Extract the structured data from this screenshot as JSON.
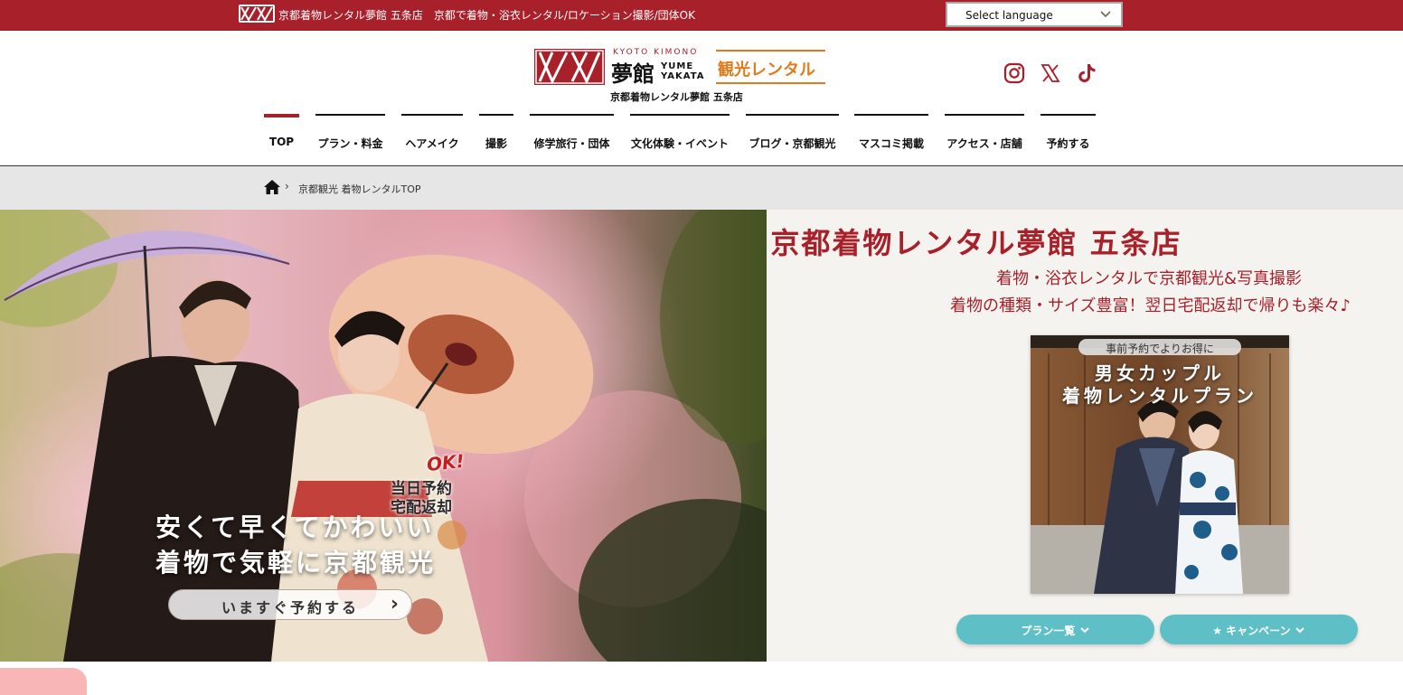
{
  "topbar": {
    "tagline": "京都着物レンタル夢館 五条店　京都で着物・浴衣レンタル/ロケーション撮影/団体OK",
    "language_select": "Select language"
  },
  "brand": {
    "kyoto_kimono": "KYOTO KIMONO",
    "kanji": "夢館",
    "yume_yakata_1": "YUME",
    "yume_yakata_2": "YAKATA",
    "tag": "観光レンタル",
    "store_sub": "京都着物レンタル夢館 五条店"
  },
  "social": [
    "instagram-icon",
    "x-icon",
    "tiktok-icon"
  ],
  "nav": {
    "items": [
      {
        "label": "TOP"
      },
      {
        "label": "プラン・料金"
      },
      {
        "label": "ヘアメイク"
      },
      {
        "label": "撮影"
      },
      {
        "label": "修学旅行・団体"
      },
      {
        "label": "文化体験・イベント"
      },
      {
        "label": "ブログ・京都観光"
      },
      {
        "label": "マスコミ掲載"
      },
      {
        "label": "アクセス・店舗"
      },
      {
        "label": "予約する"
      }
    ]
  },
  "breadcrumb": {
    "separator": "›",
    "current": "京都観光 着物レンタルTOP"
  },
  "hero": {
    "badge_ok": "OK!",
    "badge_line1": "当日予約",
    "badge_line2": "宅配返却",
    "line1": "安くて早くてかわいい",
    "line2": "着物で気軽に京都観光",
    "cta": "いますぐ予約する",
    "cta_arrow": "›"
  },
  "intro": {
    "title": "京都着物レンタル夢館 五条店",
    "lead1": "着物・浴衣レンタルで京都観光&写真撮影",
    "lead2": "着物の種類・サイズ豊富！翌日宅配返却で帰りも楽々♪"
  },
  "promo": {
    "pill": "事前予約でよりお得に",
    "line1": "男女カップル",
    "line2": "着物レンタルプラン"
  },
  "buttons": {
    "plans": "プラン一覧",
    "campaign": "キャンペーン",
    "chevron": "⌄",
    "star": "★"
  },
  "colors": {
    "brand_red": "#a8202a",
    "accent_orange": "#e07a1a",
    "teal": "#5fbfc7"
  }
}
